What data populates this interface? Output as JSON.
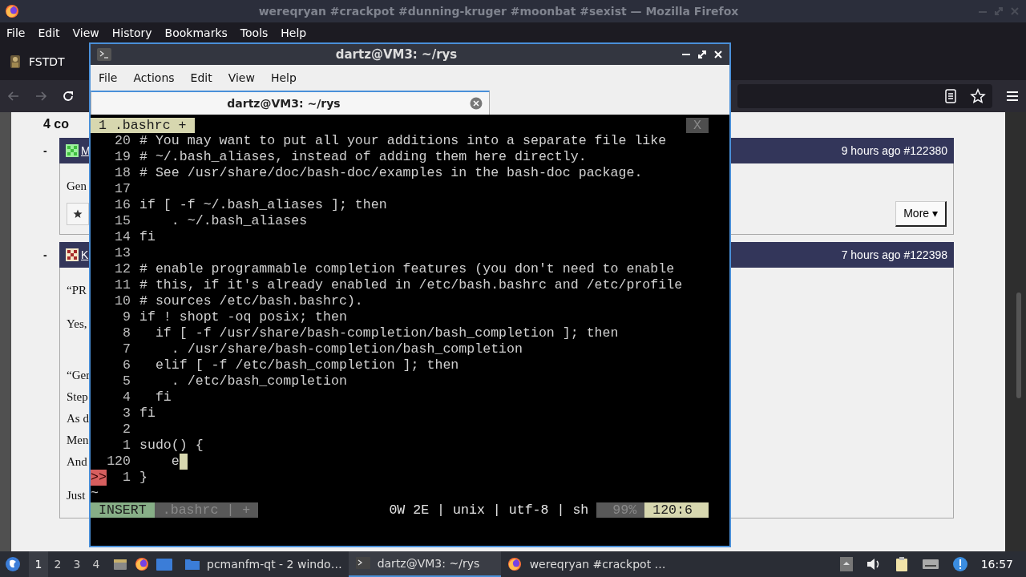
{
  "browser": {
    "title": "wereqryan #crackpot #dunning-kruger #moonbat #sexist — Mozilla Firefox",
    "menu": [
      "File",
      "Edit",
      "View",
      "History",
      "Bookmarks",
      "Tools",
      "Help"
    ],
    "tabs": [
      {
        "label": "FSTDT",
        "selected": true
      }
    ],
    "page": {
      "heading": "4 co",
      "comments": [
        {
          "marker": "-",
          "author": "M",
          "meta": "9 hours ago #122380",
          "paragraphs": [
            [
              "Gen"
            ]
          ],
          "more": "More ▾"
        },
        {
          "marker": "-",
          "author": "K",
          "meta": "7 hours ago #122398",
          "paragraphs": [
            [
              "“PR"
            ],
            [
              "Yes,"
            ],
            [
              "“Ger",
              "Step",
              "As d",
              "Men",
              "And"
            ],
            [
              "Just"
            ]
          ]
        }
      ]
    }
  },
  "terminal": {
    "title": "dartz@VM3: ~/rys",
    "menu": [
      "File",
      "Actions",
      "Edit",
      "View",
      "Help"
    ],
    "tabs": [
      {
        "label": "dartz@VM3: ~/rys",
        "selected": true
      }
    ],
    "editor": {
      "tabline": {
        "label": "1 .bashrc +",
        "close": "X"
      },
      "lines": [
        {
          "number": "20",
          "text": "# You may want to put all your additions into a separate file like",
          "cursor": false
        },
        {
          "number": "19",
          "text": "# ~/.bash_aliases, instead of adding them here directly.",
          "cursor": false
        },
        {
          "number": "18",
          "text": "# See /usr/share/doc/bash-doc/examples in the bash-doc package.",
          "cursor": false
        },
        {
          "number": "17",
          "cursor": false
        },
        {
          "number": "16",
          "text": "if [ -f ~/.bash_aliases ]; then",
          "cursor": false
        },
        {
          "number": "15",
          "text": "    . ~/.bash_aliases",
          "cursor": false
        },
        {
          "number": "14",
          "text": "fi",
          "cursor": false
        },
        {
          "number": "13",
          "cursor": false
        },
        {
          "number": "12",
          "text": "# enable programmable completion features (you don't need to enable",
          "cursor": false
        },
        {
          "number": "11",
          "text": "# this, if it's already enabled in /etc/bash.bashrc and /etc/profile",
          "cursor": false
        },
        {
          "number": "10",
          "text": "# sources /etc/bash.bashrc).",
          "cursor": false
        },
        {
          "number": "9",
          "text": "if ! shopt -oq posix; then",
          "cursor": false
        },
        {
          "number": "8",
          "text": "  if [ -f /usr/share/bash-completion/bash_completion ]; then",
          "cursor": false
        },
        {
          "number": "7",
          "text": "    . /usr/share/bash-completion/bash_completion",
          "cursor": false
        },
        {
          "number": "6",
          "text": "  elif [ -f /etc/bash_completion ]; then",
          "cursor": false
        },
        {
          "number": "5",
          "text": "    . /etc/bash_completion",
          "cursor": false
        },
        {
          "number": "4",
          "text": "  fi",
          "cursor": false
        },
        {
          "number": "3",
          "text": "fi",
          "cursor": false
        },
        {
          "number": "2",
          "cursor": false
        },
        {
          "number": "1",
          "text": "sudo() {",
          "cursor": false
        },
        {
          "number": "120",
          "text": "    e",
          "cursor": true
        },
        {
          "number": "1",
          "text": "}",
          "sign": ">>",
          "cursor": false
        }
      ],
      "tilde": "~",
      "status": {
        "mode": "INSERT",
        "file": ".bashrc | +",
        "info": "0W 2E | unix | utf-8 | sh",
        "percent": "99%",
        "position": "120:6"
      }
    }
  },
  "taskbar": {
    "workspaces": [
      {
        "label": "1",
        "selected": true
      },
      {
        "label": "2",
        "selected": false
      },
      {
        "label": "3",
        "selected": false
      },
      {
        "label": "4",
        "selected": false
      }
    ],
    "tasks": [
      {
        "label": "pcmanfm-qt - 2 windo…",
        "kind": "folder",
        "selected": false
      },
      {
        "label": "dartz@VM3: ~/rys",
        "kind": "terminal",
        "selected": true
      },
      {
        "label": "wereqryan #crackpot …",
        "kind": "firefox",
        "selected": false
      }
    ],
    "clock": "16:57"
  }
}
